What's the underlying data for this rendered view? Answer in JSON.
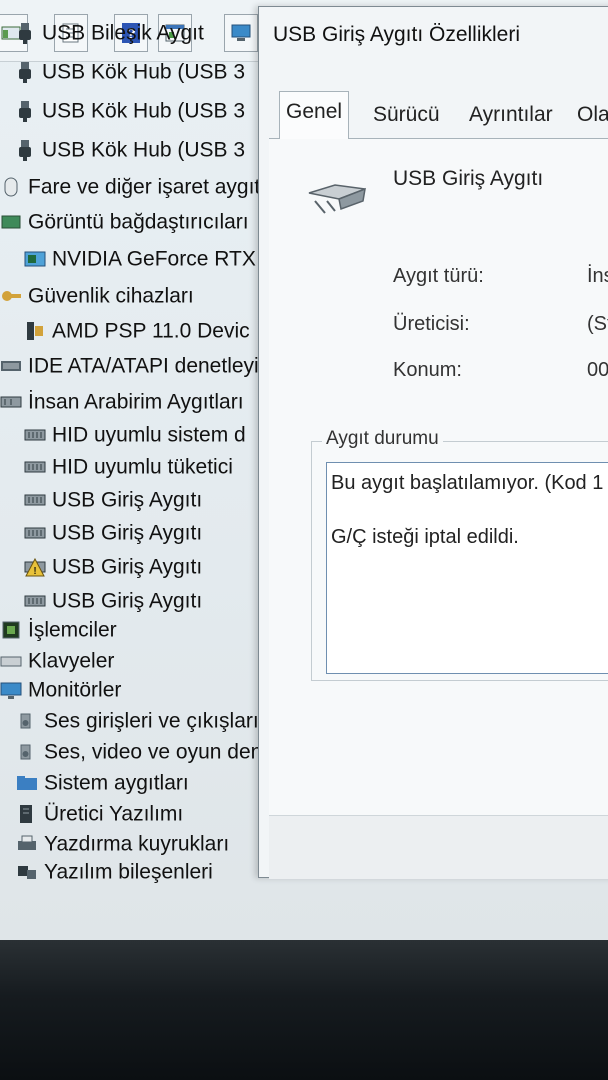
{
  "dialog": {
    "title": "USB Giriş Aygıtı Özellikleri",
    "tabs": [
      "Genel",
      "Sürücü",
      "Ayrıntılar",
      "Ola"
    ],
    "active_tab": "Genel",
    "device_name": "USB Giriş Aygıtı",
    "properties": [
      {
        "label": "Aygıt türü:",
        "value": "İns"
      },
      {
        "label": "Üreticisi:",
        "value": "(St"
      },
      {
        "label": "Konum:",
        "value": "00"
      }
    ],
    "status_group_label": "Aygıt durumu",
    "status_lines": [
      "Bu aygıt başlatılamıyor. (Kod 1",
      "G/Ç isteği iptal edildi."
    ]
  },
  "tree": [
    {
      "label": "USB Bileşik Aygıt",
      "icon": "usb-plug-icon",
      "level": 2
    },
    {
      "label": "USB Kök Hub (USB 3",
      "icon": "usb-plug-icon",
      "level": 2
    },
    {
      "label": "USB Kök Hub (USB 3",
      "icon": "usb-plug-icon",
      "level": 2
    },
    {
      "label": "USB Kök Hub (USB 3",
      "icon": "usb-plug-icon",
      "level": 2
    },
    {
      "label": "Fare ve diğer işaret aygıt",
      "icon": "mouse-icon",
      "level": 1
    },
    {
      "label": "Görüntü bağdaştırıcıları",
      "icon": "display-adapter-icon",
      "level": 1
    },
    {
      "label": "NVIDIA GeForce RTX",
      "icon": "gpu-icon",
      "level": 2
    },
    {
      "label": "Güvenlik cihazları",
      "icon": "key-icon",
      "level": 1
    },
    {
      "label": "AMD PSP 11.0 Devic",
      "icon": "security-chip-icon",
      "level": 2
    },
    {
      "label": "IDE ATA/ATAPI denetleyi",
      "icon": "ide-controller-icon",
      "level": 1
    },
    {
      "label": "İnsan Arabirim Aygıtları",
      "icon": "hid-icon",
      "level": 1
    },
    {
      "label": "HID uyumlu sistem d",
      "icon": "hid-device-icon",
      "level": 2
    },
    {
      "label": "HID uyumlu tüketici",
      "icon": "hid-device-icon",
      "level": 2
    },
    {
      "label": "USB Giriş Aygıtı",
      "icon": "hid-device-icon",
      "level": 2
    },
    {
      "label": "USB Giriş Aygıtı",
      "icon": "hid-device-icon",
      "level": 2
    },
    {
      "label": "USB Giriş Aygıtı",
      "icon": "hid-warning-icon",
      "level": 2
    },
    {
      "label": "USB Giriş Aygıtı",
      "icon": "hid-device-icon",
      "level": 2
    },
    {
      "label": "İşlemciler",
      "icon": "processor-icon",
      "level": 1
    },
    {
      "label": "Klavyeler",
      "icon": "keyboard-icon",
      "level": 1
    },
    {
      "label": "Monitörler",
      "icon": "monitor-icon",
      "level": 1
    },
    {
      "label": "Ses girişleri ve çıkışları",
      "icon": "speaker-icon",
      "level": 1
    },
    {
      "label": "Ses, video ve oyun dene",
      "icon": "speaker-icon",
      "level": 1
    },
    {
      "label": "Sistem aygıtları",
      "icon": "folder-icon",
      "level": 1
    },
    {
      "label": "Üretici Yazılımı",
      "icon": "firmware-icon",
      "level": 1
    },
    {
      "label": "Yazdırma kuyrukları",
      "icon": "printer-icon",
      "level": 1
    },
    {
      "label": "Yazılım bileşenleri",
      "icon": "software-component-icon",
      "level": 1
    }
  ],
  "toolbar": {
    "icons": [
      "show-hide-console-icon",
      "properties-icon",
      "help-icon",
      "action-pane-icon",
      "scan-hardware-icon"
    ]
  }
}
